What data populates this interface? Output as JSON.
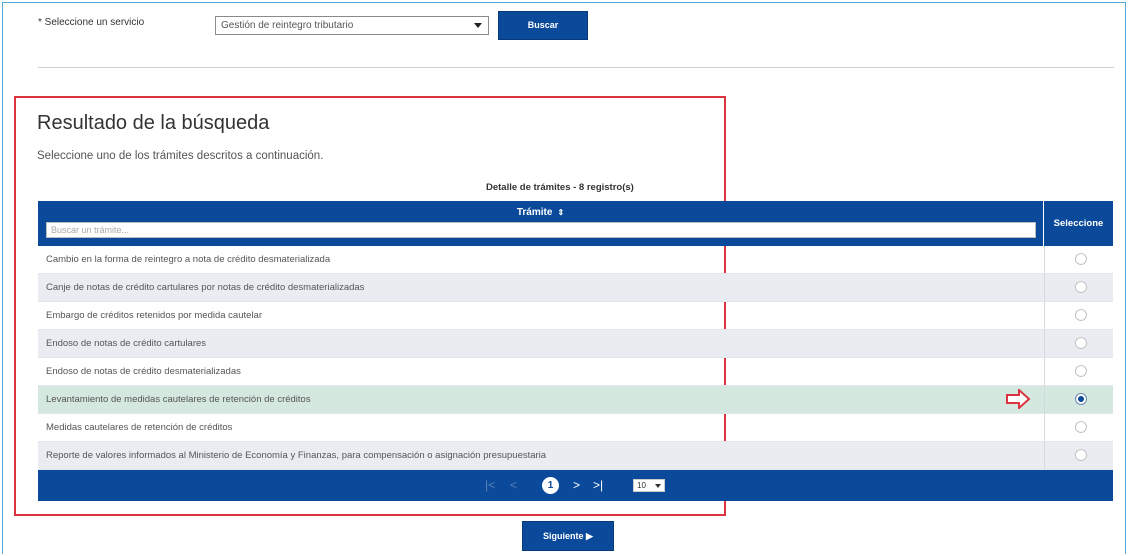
{
  "service": {
    "label": "* Seleccione un servicio",
    "selected": "Gestión de reintegro tributario",
    "search_button": "Buscar"
  },
  "results": {
    "title": "Resultado de la búsqueda",
    "subtitle": "Seleccione uno de los trámites descritos a continuación.",
    "detail": "Detalle de trámites - 8 registro(s)",
    "columns": {
      "tramite": "Trámite",
      "sort_glyph": "⇕",
      "select": "Seleccione"
    },
    "filter_placeholder": "Buscar un trámite...",
    "rows": [
      {
        "text": "Cambio en la forma de reintegro a nota de crédito desmaterializada",
        "selected": false
      },
      {
        "text": "Canje de notas de crédito cartulares por notas de crédito desmaterializadas",
        "selected": false
      },
      {
        "text": "Embargo de créditos retenidos por medida cautelar",
        "selected": false
      },
      {
        "text": "Endoso de notas de crédito cartulares",
        "selected": false
      },
      {
        "text": "Endoso de notas de crédito desmaterializadas",
        "selected": false
      },
      {
        "text": "Levantamiento de medidas cautelares de retención de créditos",
        "selected": true
      },
      {
        "text": "Medidas cautelares de retención de créditos",
        "selected": false
      },
      {
        "text": "Reporte de valores informados al Ministerio de Economía y Finanzas, para compensación o asignación presupuestaria",
        "selected": false
      }
    ],
    "pager": {
      "first": "|<",
      "prev": "<",
      "current_page": "1",
      "next": ">",
      "last": ">|",
      "page_size": "10"
    }
  },
  "next_button": "Siguiente ▶",
  "colors": {
    "primary": "#0b4a9b",
    "annotation": "#d9343f",
    "selected_row": "#d4e8e0",
    "alt_row": "#e9edf2"
  }
}
